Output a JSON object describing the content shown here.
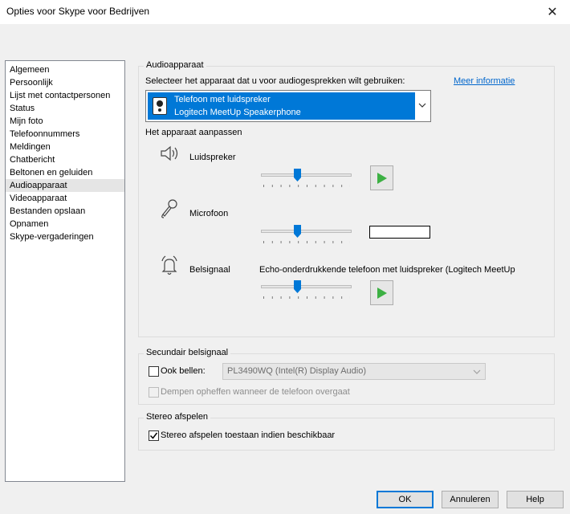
{
  "window": {
    "title": "Opties voor Skype voor Bedrijven",
    "close_symbol": "✕"
  },
  "sidebar": {
    "selected_index": 9,
    "items": [
      {
        "label": "Algemeen"
      },
      {
        "label": "Persoonlijk"
      },
      {
        "label": "Lijst met contactpersonen"
      },
      {
        "label": "Status"
      },
      {
        "label": "Mijn foto"
      },
      {
        "label": "Telefoonnummers"
      },
      {
        "label": "Meldingen"
      },
      {
        "label": "Chatbericht"
      },
      {
        "label": "Beltonen en geluiden"
      },
      {
        "label": "Audioapparaat"
      },
      {
        "label": "Videoapparaat"
      },
      {
        "label": "Bestanden opslaan"
      },
      {
        "label": "Opnamen"
      },
      {
        "label": "Skype-vergaderingen"
      }
    ]
  },
  "audio_device": {
    "legend": "Audioapparaat",
    "instruction": "Selecteer het apparaat dat u voor audiogesprekken wilt gebruiken:",
    "more_info_link": "Meer informatie",
    "selected_device_line1": "Telefoon met luidspreker",
    "selected_device_line2": "Logitech MeetUp Speakerphone",
    "customize_heading": "Het apparaat aanpassen",
    "speaker": {
      "label": "Luidspreker",
      "volume_percent": 40
    },
    "microphone": {
      "label": "Microfoon",
      "volume_percent": 40
    },
    "ringer": {
      "label": "Belsignaal",
      "device_text": "Echo-onderdrukkende telefoon met luidspreker (Logitech MeetUp",
      "volume_percent": 40
    }
  },
  "secondary_ringer": {
    "legend": "Secundair belsignaal",
    "also_ring_label": "Ook bellen:",
    "also_ring_checked": false,
    "also_ring_device": "PL3490WQ (Intel(R) Display Audio)",
    "unmute_label": "Dempen opheffen wanneer de telefoon overgaat",
    "unmute_checked": false
  },
  "stereo": {
    "legend": "Stereo afspelen",
    "allow_label": "Stereo afspelen toestaan indien beschikbaar",
    "allow_checked": true
  },
  "footer": {
    "ok_label": "OK",
    "cancel_label": "Annuleren",
    "help_label": "Help"
  },
  "colors": {
    "selection": "#0078d7",
    "play_green": "#3cb043",
    "link": "#0066cc"
  }
}
